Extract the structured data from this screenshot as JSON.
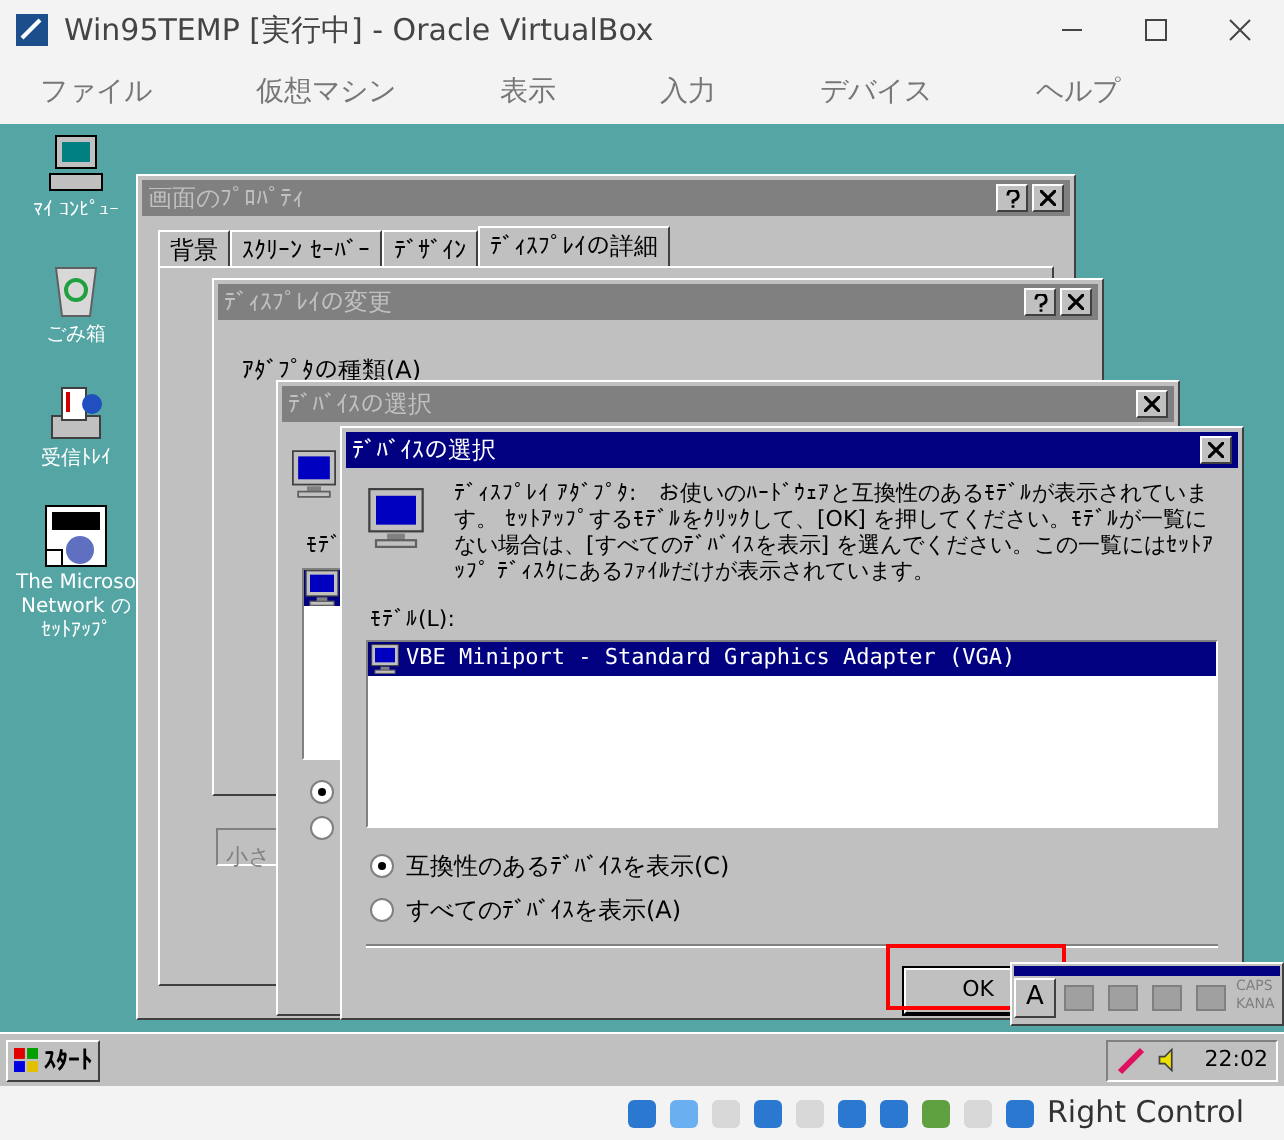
{
  "window": {
    "title": "Win95TEMP [実行中] - Oracle VirtualBox"
  },
  "menu": [
    "ファイル",
    "仮想マシン",
    "表示",
    "入力",
    "デバイス",
    "ヘルプ"
  ],
  "desktop_icons": [
    {
      "kind": "computer",
      "lines": [
        "ﾏｲ ｺﾝﾋﾟｭｰ"
      ]
    },
    {
      "kind": "trash",
      "lines": [
        "ごみ箱"
      ]
    },
    {
      "kind": "inbox",
      "lines": [
        "受信ﾄﾚｲ"
      ]
    },
    {
      "kind": "msn",
      "lines": [
        "The Microso",
        "Network の",
        "ｾｯﾄｱｯﾌﾟ"
      ]
    }
  ],
  "properties_window": {
    "title": "画面のﾌﾟﾛﾊﾟﾃｨ",
    "tabs": [
      {
        "label": "背景",
        "selected": false
      },
      {
        "label": "ｽｸﾘｰﾝ ｾｰﾊﾞｰ",
        "selected": false
      },
      {
        "label": "ﾃﾞｻﾞｲﾝ",
        "selected": false
      },
      {
        "label": "ﾃﾞｨｽﾌﾟﾚｲの詳細",
        "selected": true
      }
    ],
    "field_value": "小さ"
  },
  "change_window": {
    "title": "ﾃﾞｨｽﾌﾟﾚｲの変更",
    "group_label": "ｱﾀﾞﾌﾟﾀの種類(A)"
  },
  "back_select_window": {
    "title": "ﾃﾞﾊﾞｲｽの選択",
    "list_label": "ﾓﾃﾞ",
    "radios": [
      {
        "selected": true
      },
      {
        "selected": false
      }
    ]
  },
  "dialog": {
    "title": "ﾃﾞﾊﾞｲｽの選択",
    "description": "ﾃﾞｨｽﾌﾟﾚｲ ｱﾀﾞﾌﾟﾀ:　お使いのﾊｰﾄﾞｳｪｱと互換性のあるﾓﾃﾞﾙが表示されています。 ｾｯﾄｱｯﾌﾟするﾓﾃﾞﾙをｸﾘｯｸして、[OK] を押してください。ﾓﾃﾞﾙが一覧にない場合は、[すべてのﾃﾞﾊﾞｲｽを表示] を選んでください。この一覧にはｾｯﾄｱｯﾌﾟ ﾃﾞｨｽｸにあるﾌｧｲﾙだけが表示されています。",
    "list_label": "ﾓﾃﾞﾙ(L):",
    "models": [
      {
        "label": "VBE Miniport - Standard Graphics Adapter (VGA)",
        "selected": true
      }
    ],
    "options": [
      {
        "label": "互換性のあるﾃﾞﾊﾞｲｽを表示(C)",
        "selected": true
      },
      {
        "label": "すべてのﾃﾞﾊﾞｲｽを表示(A)",
        "selected": false
      }
    ],
    "ok_button": "OK",
    "ok_highlighted": true
  },
  "ime_toolbar": {
    "mode": "A",
    "caps": "CAPS",
    "kana": "KANA"
  },
  "taskbar": {
    "start": "ｽﾀｰﾄ",
    "clock": "22:02"
  },
  "status_bar": {
    "host_key": "Right Control"
  }
}
